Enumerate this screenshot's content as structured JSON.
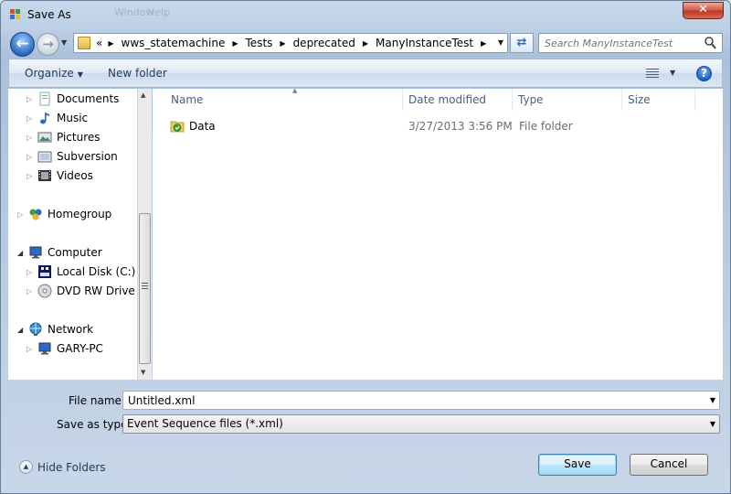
{
  "window": {
    "title": "Save As",
    "background_ghost": [
      "Window",
      "Help"
    ]
  },
  "address": {
    "overflow": "«",
    "crumbs": [
      "wws_statemachine",
      "Tests",
      "deprecated",
      "ManyInstanceTest"
    ]
  },
  "search": {
    "placeholder": "Search ManyInstanceTest"
  },
  "toolbar": {
    "organize_label": "Organize",
    "new_folder_label": "New folder",
    "help_label": "?"
  },
  "nav": {
    "items": [
      {
        "label": "Documents",
        "icon": "documents-icon"
      },
      {
        "label": "Music",
        "icon": "music-icon"
      },
      {
        "label": "Pictures",
        "icon": "pictures-icon"
      },
      {
        "label": "Subversion",
        "icon": "subversion-icon"
      },
      {
        "label": "Videos",
        "icon": "videos-icon"
      },
      {
        "label": "Homegroup",
        "icon": "homegroup-icon"
      },
      {
        "label": "Computer",
        "icon": "computer-icon"
      },
      {
        "label": "Local Disk (C:)",
        "icon": "local-disk-icon"
      },
      {
        "label": "DVD RW Drive (D",
        "icon": "dvd-drive-icon"
      },
      {
        "label": "Network",
        "icon": "network-icon"
      },
      {
        "label": "GARY-PC",
        "icon": "pc-icon"
      }
    ]
  },
  "file_list": {
    "columns": [
      "Name",
      "Date modified",
      "Type",
      "Size"
    ],
    "rows": [
      {
        "name": "Data",
        "date_modified": "3/27/2013 3:56 PM",
        "type": "File folder",
        "size": ""
      }
    ]
  },
  "form": {
    "file_name_label": "File name:",
    "file_name_value": "Untitled.xml",
    "save_type_label": "Save as type:",
    "save_type_value": "Event Sequence files (*.xml)"
  },
  "footer": {
    "hide_folders_label": "Hide Folders",
    "save_label": "Save",
    "cancel_label": "Cancel"
  }
}
